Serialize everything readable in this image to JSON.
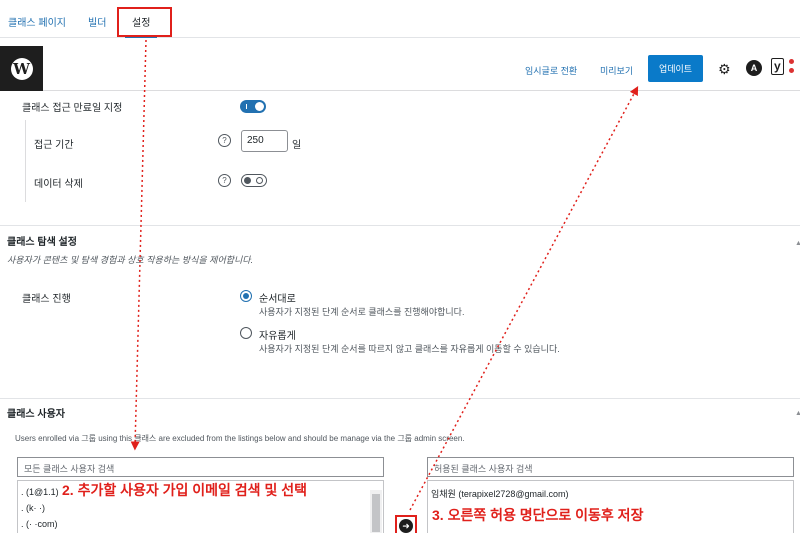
{
  "tabs": [
    {
      "label": "클래스 페이지"
    },
    {
      "label": "빌더"
    },
    {
      "label": "설정"
    }
  ],
  "toolbar": {
    "draft_label": "임시글로 전환",
    "preview_label": "미리보기",
    "update_label": "업데이트",
    "astra_label": "A",
    "yoast_label": "y"
  },
  "access": {
    "expiry_label": "클래스 접근 만료일 지정",
    "expiry_on": true,
    "period_label": "접근 기간",
    "period_value": "250",
    "period_unit": "일",
    "delete_label": "데이터 삭제",
    "delete_on": false,
    "help": "?"
  },
  "navigation": {
    "heading": "클래스 탐색 설정",
    "description": "사용자가 콘텐츠 및 탐색 경험과 상호 작용하는 방식을 제어합니다.",
    "progress_label": "클래스 진행",
    "options": [
      {
        "title": "순서대로",
        "desc": "사용자가 지정된 단계 순서로 클래스를 진행해야합니다.",
        "checked": true
      },
      {
        "title": "자유롭게",
        "desc": "사용자가 지정된 단계 순서를 따르지 않고 클래스를 자유롭게 이동할 수 있습니다.",
        "checked": false
      }
    ]
  },
  "users": {
    "heading": "클래스 사용자",
    "note": "Users enrolled via 그룹 using this 클래스 are excluded from the listings below and should be manage via the 그룹 admin screen.",
    "all_placeholder": "모든 클래스 사용자 검색",
    "allowed_placeholder": "허용된 클래스 사용자 검색",
    "all_list": [
      ". (1@1.1)",
      ". (k·           ·)",
      ". (·     ·com)"
    ],
    "allowed_list": [
      "임채원 (terapixel2728@gmail.com)"
    ],
    "move_icon": "➜"
  },
  "annotations": {
    "step2": "2. 추가할 사용자 가입 이메일 검색 및 선택",
    "step3": "3. 오른쪽 허용 명단으로 이동후 저장"
  },
  "colors": {
    "accent": "#2271b1",
    "update": "#0a7ac9",
    "annotation": "#e0201b"
  }
}
